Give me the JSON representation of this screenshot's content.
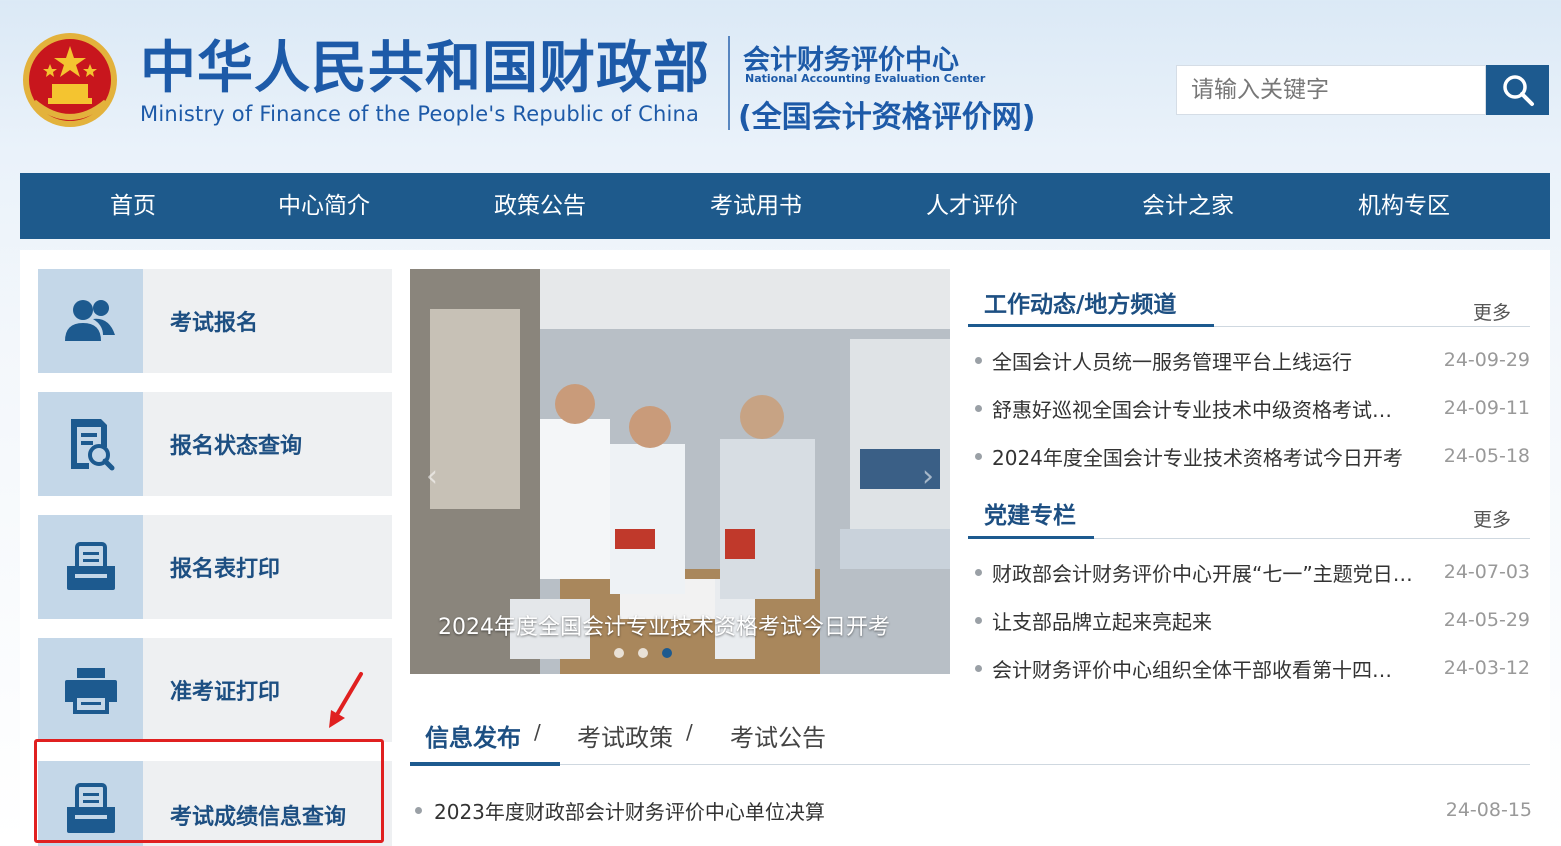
{
  "header": {
    "title_cn": "中华人民共和国财政部",
    "title_en": "Ministry of Finance of the People's Republic of China",
    "center_cn": "会计财务评价中心",
    "center_en": "National Accounting Evaluation Center",
    "center_sub": "(全国会计资格评价网)",
    "search_placeholder": "请输入关键字"
  },
  "nav": {
    "items": [
      "首页",
      "中心简介",
      "政策公告",
      "考试用书",
      "人才评价",
      "会计之家",
      "机构专区"
    ]
  },
  "quick_links": [
    {
      "label": "考试报名",
      "icon": "users-icon"
    },
    {
      "label": "报名状态查询",
      "icon": "document-search-icon"
    },
    {
      "label": "报名表打印",
      "icon": "form-print-icon"
    },
    {
      "label": "准考证打印",
      "icon": "printer-icon"
    },
    {
      "label": "考试成绩信息查询",
      "icon": "tray-icon"
    }
  ],
  "slide": {
    "caption": "2024年度全国会计专业技术资格考试今日开考"
  },
  "work_news": {
    "title": "工作动态/地方频道",
    "more": "更多",
    "items": [
      {
        "title": "全国会计人员统一服务管理平台上线运行",
        "date": "24-09-29"
      },
      {
        "title": "舒惠好巡视全国会计专业技术中级资格考试…",
        "date": "24-09-11"
      },
      {
        "title": "2024年度全国会计专业技术资格考试今日开考",
        "date": "24-05-18"
      }
    ]
  },
  "party_news": {
    "title": "党建专栏",
    "more": "更多",
    "items": [
      {
        "title": "财政部会计财务评价中心开展“七一”主题党日…",
        "date": "24-07-03"
      },
      {
        "title": "让支部品牌立起来亮起来",
        "date": "24-05-29"
      },
      {
        "title": "会计财务评价中心组织全体干部收看第十四…",
        "date": "24-03-12"
      }
    ]
  },
  "tabs": {
    "items": [
      "信息发布",
      "考试政策",
      "考试公告"
    ],
    "separator": "/"
  },
  "info_news": [
    {
      "title": "2023年度财政部会计财务评价中心单位决算",
      "date": "24-08-15"
    }
  ],
  "colors": {
    "brand_blue": "#1d5aa8",
    "nav_bg": "#1e5a8c",
    "annotation_red": "#e02020"
  }
}
